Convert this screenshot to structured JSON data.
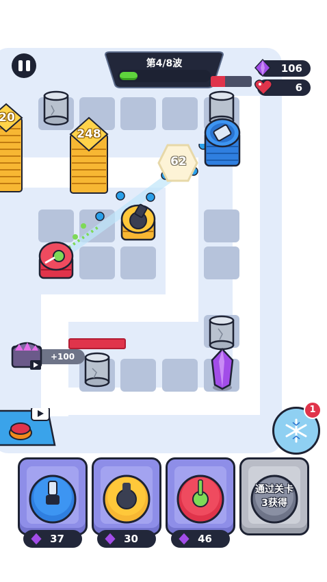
{
  "hud": {
    "wave_label": "第4/8波",
    "wave_progress": 0.2,
    "enemy_hp_fraction": 0.35,
    "gems": "106",
    "lives": "6"
  },
  "board": {
    "stack_left_value": "20",
    "stack_mid_value": "248",
    "damage_value": "62",
    "chest_reward": "+100"
  },
  "freeze": {
    "badge_count": "1"
  },
  "cards": [
    {
      "kind": "blue-cannon",
      "price": "37"
    },
    {
      "kind": "yellow-mortar",
      "price": "30"
    },
    {
      "kind": "red-sniper",
      "price": "46"
    }
  ],
  "locked_card": {
    "line1": "通过关卡",
    "line2": "3获得"
  },
  "colors": {
    "accent_gem": "#a24de8",
    "health_red": "#e0344b",
    "wave_green": "#5fd43d",
    "panel_dark": "#22273a"
  }
}
